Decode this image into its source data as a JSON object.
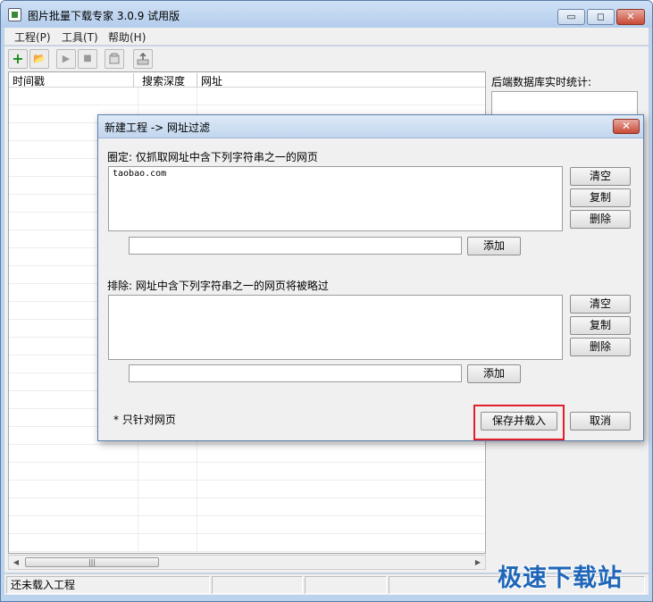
{
  "window": {
    "title": "图片批量下载专家 3.0.9 试用版"
  },
  "window_controls": {
    "minimize": "▭",
    "maximize": "◻",
    "close": "✕"
  },
  "menu": [
    "工程(P)",
    "工具(T)",
    "帮助(H)"
  ],
  "toolbar": {
    "new": "+",
    "open": "📂",
    "run": "▶",
    "stop": "■"
  },
  "grid": {
    "columns": [
      "时间戳",
      "搜索深度",
      "网址"
    ]
  },
  "stats": {
    "label": "后端数据库实时统计:"
  },
  "scrollbar": {
    "left": "◀",
    "right": "▶",
    "grip": "|||"
  },
  "status": [
    "还未载入工程",
    "",
    "",
    ""
  ],
  "watermark": "极速下载站",
  "dialog": {
    "title": "新建工程 -> 网址过滤",
    "close": "✕",
    "include": {
      "label": "圈定: 仅抓取网址中含下列字符串之一的网页",
      "entries": [
        "taobao.com"
      ],
      "input_value": "",
      "clear": "清空",
      "copy": "复制",
      "delete": "删除",
      "add": "添加"
    },
    "exclude": {
      "label": "排除: 网址中含下列字符串之一的网页将被略过",
      "entries": [],
      "input_value": "",
      "clear": "清空",
      "copy": "复制",
      "delete": "删除",
      "add": "添加"
    },
    "note": "* 只针对网页",
    "save": "保存并载入",
    "cancel": "取消"
  }
}
